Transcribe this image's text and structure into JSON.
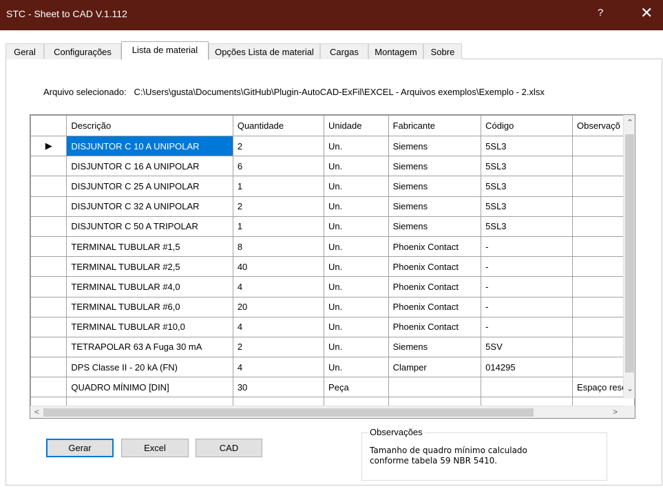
{
  "window": {
    "title": "STC - Sheet to CAD V.1.112",
    "help_glyph": "?",
    "close_glyph": "✕"
  },
  "tabs": [
    {
      "label": "Geral"
    },
    {
      "label": "Configurações"
    },
    {
      "label": "Lista de material",
      "active": true
    },
    {
      "label": "Opções Lista de material"
    },
    {
      "label": "Cargas"
    },
    {
      "label": "Montagem"
    },
    {
      "label": "Sobre"
    }
  ],
  "file": {
    "label": "Arquivo selecionado:",
    "path": "C:\\Users\\gusta\\Documents\\GitHub\\Plugin-AutoCAD-ExFil\\EXCEL - Arquivos exemplos\\Exemplo - 2.xlsx"
  },
  "grid": {
    "columns": [
      "Descrição",
      "Quantidade",
      "Unidade",
      "Fabricante",
      "Código",
      "Observaçõ"
    ],
    "current_row_marker": "▶",
    "rows": [
      [
        "DISJUNTOR C 10 A UNIPOLAR",
        "2",
        "Un.",
        "Siemens",
        "5SL3",
        ""
      ],
      [
        "DISJUNTOR C 16 A UNIPOLAR",
        "6",
        "Un.",
        "Siemens",
        "5SL3",
        ""
      ],
      [
        "DISJUNTOR C 25 A UNIPOLAR",
        "1",
        "Un.",
        "Siemens",
        "5SL3",
        ""
      ],
      [
        "DISJUNTOR C 32 A UNIPOLAR",
        "2",
        "Un.",
        "Siemens",
        "5SL3",
        ""
      ],
      [
        "DISJUNTOR C 50 A TRIPOLAR",
        "1",
        "Un.",
        "Siemens",
        "5SL3",
        ""
      ],
      [
        "TERMINAL TUBULAR #1,5",
        "8",
        "Un.",
        "Phoenix Contact",
        "-",
        ""
      ],
      [
        "TERMINAL TUBULAR #2,5",
        "40",
        "Un.",
        "Phoenix Contact",
        "-",
        ""
      ],
      [
        "TERMINAL TUBULAR #4,0",
        "4",
        "Un.",
        "Phoenix Contact",
        "-",
        ""
      ],
      [
        "TERMINAL TUBULAR #6,0",
        "20",
        "Un.",
        "Phoenix Contact",
        "-",
        ""
      ],
      [
        "TERMINAL TUBULAR #10,0",
        "4",
        "Un.",
        "Phoenix Contact",
        "-",
        ""
      ],
      [
        "TETRAPOLAR 63 A Fuga 30 mA",
        "2",
        "Un.",
        "Siemens",
        "5SV",
        ""
      ],
      [
        "DPS Classe II - 20 kA (FN)",
        "4",
        "Un.",
        "Clamper",
        "014295",
        ""
      ],
      [
        "QUADRO MÍNIMO [DIN]",
        "30",
        "Peça",
        "",
        "",
        "Espaço rese"
      ]
    ],
    "scroll_up": "⌃",
    "scroll_down": "⌄",
    "scroll_left": "<",
    "scroll_right": ">"
  },
  "buttons": {
    "gerar": "Gerar",
    "excel": "Excel",
    "cad": "CAD"
  },
  "observacoes": {
    "title": "Observações",
    "text": "Tamanho de quadro mínimo calculado\nconforme tabela 59 NBR 5410."
  },
  "colors": {
    "titlebar": "#5c1c12",
    "selection": "#0078d7"
  }
}
